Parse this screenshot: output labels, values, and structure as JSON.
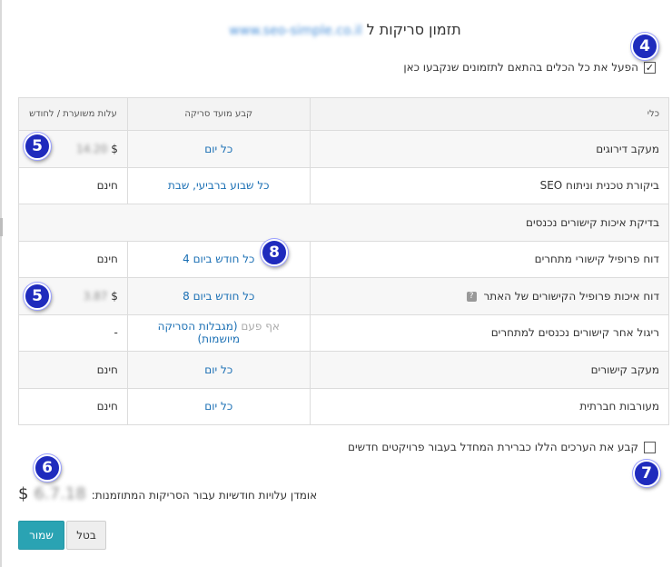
{
  "title": {
    "prefix": "תזמון סריקות ל",
    "site_blurred": "www.seo-simple.co.il"
  },
  "apply_all": {
    "label": "הפעל את כל הכלים בהתאם לתזמונים שנקבעו כאן",
    "checked": true,
    "check_glyph": "✓"
  },
  "table": {
    "headers": {
      "tool": "כלי",
      "schedule": "קבע מועד סריקה",
      "cost": "עלות משוערת / לחודש"
    },
    "rows": [
      {
        "tool": "מעקב דירוגים",
        "schedule": "כל יום",
        "cost_symbol": "$",
        "cost_blurred": "14.20"
      },
      {
        "tool": "ביקורת טכנית וניתוח SEO",
        "schedule": "כל שבוע ברביעי, שבת",
        "cost": "חינם"
      },
      {
        "tool": "בדיקת איכות קישורים נכנסים",
        "section": true
      },
      {
        "tool": "דוח פרופיל קישורי מתחרים",
        "schedule": "כל חודש ביום 4",
        "cost": "חינם"
      },
      {
        "tool": "דוח איכות פרופיל הקישורים של האתר",
        "help_icon": "?",
        "schedule": "כל חודש ביום 8",
        "cost_symbol": "$",
        "cost_blurred": "3.87"
      },
      {
        "tool": "ריגול אחר קישורים נכנסים למתחרים",
        "schedule_grey": "אף פעם",
        "schedule": "(מגבלות הסריקה מיושמות)",
        "cost": "-"
      },
      {
        "tool": "מעקב קישורים",
        "schedule": "כל יום",
        "cost": "חינם"
      },
      {
        "tool": "מעורבות חברתית",
        "schedule": "כל יום",
        "cost": "חינם"
      }
    ]
  },
  "default_setting": {
    "label": "קבע את הערכים הללו כברירת המחדל בעבור פרויקטים חדשים",
    "checked": false
  },
  "estimate": {
    "label": "אומדן עלויות חודשיות עבור הסריקות המתוזמנות:",
    "currency": "$",
    "amount_blurred": "6.7.18"
  },
  "buttons": {
    "save": "שמור",
    "cancel": "בטל"
  },
  "annotations": [
    "4",
    "5",
    "8",
    "5",
    "6",
    "7"
  ],
  "colors": {
    "accent": "#2aa3b3",
    "link": "#1a6fb4",
    "badge": "#1f2bbd"
  }
}
